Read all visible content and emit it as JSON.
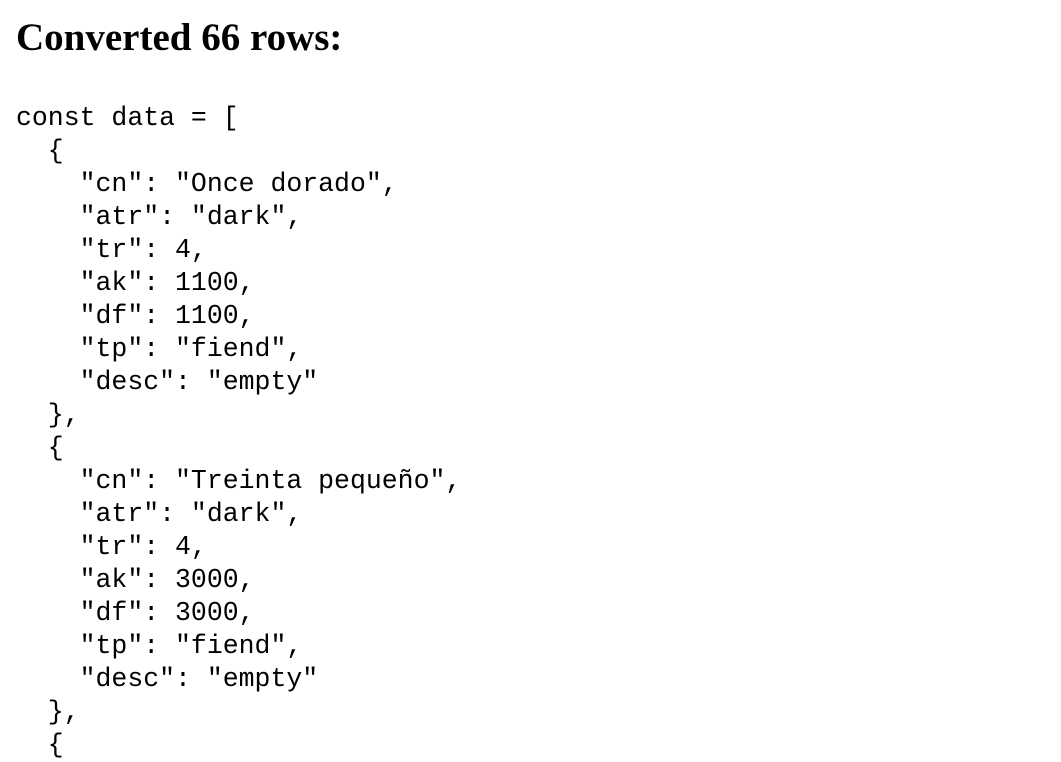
{
  "heading": "Converted 66 rows:",
  "code_lines": [
    "const data = [",
    "  {",
    "    \"cn\": \"Once dorado\",",
    "    \"atr\": \"dark\",",
    "    \"tr\": 4,",
    "    \"ak\": 1100,",
    "    \"df\": 1100,",
    "    \"tp\": \"fiend\",",
    "    \"desc\": \"empty\"",
    "  },",
    "  {",
    "    \"cn\": \"Treinta pequeño\",",
    "    \"atr\": \"dark\",",
    "    \"tr\": 4,",
    "    \"ak\": 3000,",
    "    \"df\": 3000,",
    "    \"tp\": \"fiend\",",
    "    \"desc\": \"empty\"",
    "  },",
    "  {"
  ]
}
